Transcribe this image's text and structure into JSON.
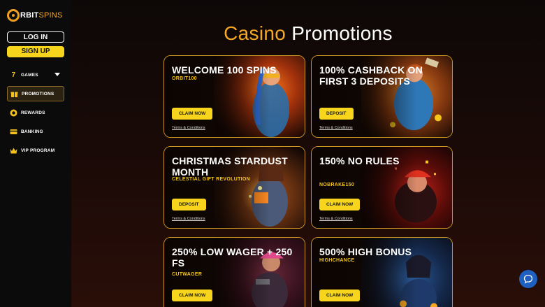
{
  "brand": {
    "logo_part1": "RBIT",
    "logo_part2": "SPINS"
  },
  "auth": {
    "login_label": "LOG IN",
    "signup_label": "SIGN UP"
  },
  "nav": {
    "items": [
      {
        "label": "GAMES",
        "icon": "seven-icon",
        "active": false,
        "has_dropdown": true
      },
      {
        "label": "PROMOTIONS",
        "icon": "gift-icon",
        "active": true,
        "has_dropdown": false
      },
      {
        "label": "REWARDS",
        "icon": "rewards-icon",
        "active": false,
        "has_dropdown": false
      },
      {
        "label": "BANKING",
        "icon": "card-icon",
        "active": false,
        "has_dropdown": false
      },
      {
        "label": "VIP PROGRAM",
        "icon": "crown-icon",
        "active": false,
        "has_dropdown": false
      }
    ]
  },
  "page": {
    "title_accent": "Casino",
    "title_rest": "Promotions"
  },
  "promos": [
    {
      "title": "WELCOME 100 SPINS",
      "code": "ORBIT100",
      "button": "CLAIM NOW",
      "terms": "Terms & Conditions"
    },
    {
      "title": "100% CASHBACK ON FIRST 3 DEPOSITS",
      "code": "",
      "button": "DEPOSIT",
      "terms": "Terms & Conditions"
    },
    {
      "title": "CHRISTMAS STARDUST MONTH",
      "code": "CELESTIAL GIFT REVOLUTION",
      "button": "DEPOSIT",
      "terms": "Terms & Conditions"
    },
    {
      "title": "150% NO RULES",
      "code": "NOBRAKE150",
      "button": "CLAIM NOW",
      "terms": "Terms & Conditions"
    },
    {
      "title": "250% LOW WAGER + 250 FS",
      "code": "CUTWAGER",
      "button": "CLAIM NOW",
      "terms": ""
    },
    {
      "title": "500% HIGH BONUS",
      "code": "HIGHCHANCE",
      "button": "CLAIM NOW",
      "terms": ""
    }
  ],
  "colors": {
    "accent_gold": "#f5a623",
    "button_yellow": "#f7d51d",
    "card_border": "#c99722",
    "chat_blue": "#1e5fbf"
  }
}
